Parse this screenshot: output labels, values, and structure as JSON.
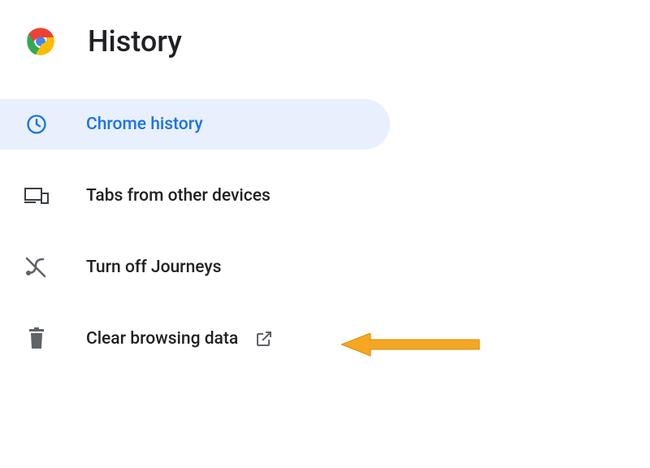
{
  "header": {
    "title": "History"
  },
  "menu": {
    "chrome_history_label": "Chrome history",
    "tabs_from_other_devices_label": "Tabs from other devices",
    "turn_off_journeys_label": "Turn off Journeys",
    "clear_browsing_data_label": "Clear browsing data"
  },
  "colors": {
    "selected_bg": "#e8f0fe",
    "selected_fg": "#1a73e8",
    "text": "#202124",
    "icon_gray": "#5f6368",
    "arrow": "#f4b400"
  }
}
